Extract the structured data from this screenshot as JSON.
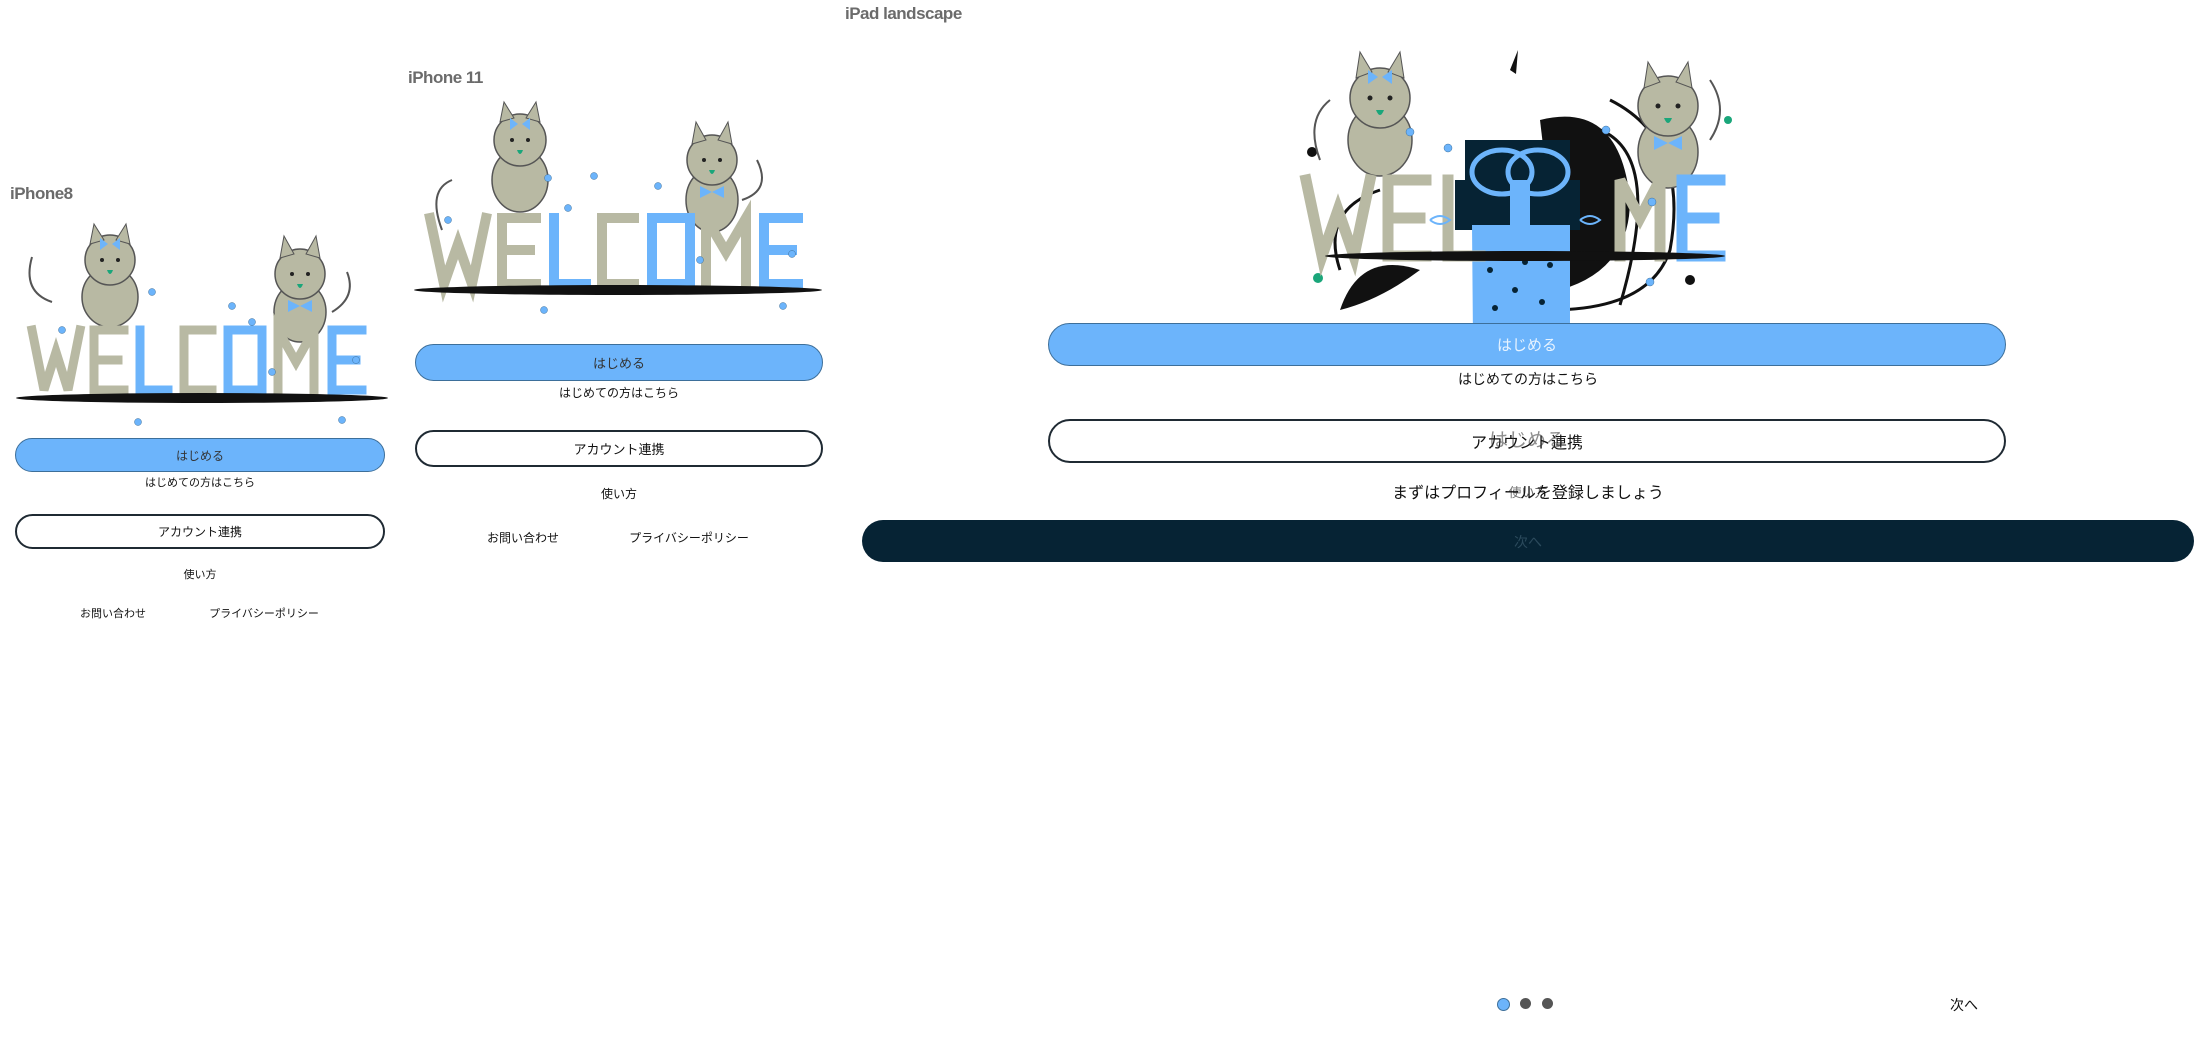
{
  "frames": {
    "phone": {
      "label": "iPhone8",
      "start_button": "はじめる",
      "first_time_text": "はじめての方はこちら",
      "account_link_button": "アカウント連携",
      "how_to_use": "使い方",
      "contact": "お問い合わせ",
      "privacy_policy": "プライバシーポリシー"
    },
    "phone11": {
      "label": "iPhone 11",
      "start_button": "はじめる",
      "first_time_text": "はじめての方はこちら",
      "account_link_button": "アカウント連携",
      "how_to_use": "使い方",
      "contact": "お問い合わせ",
      "privacy_policy": "プライバシーポリシー"
    },
    "ipad": {
      "label": "iPad landscape",
      "illustration_word": "WELCOME",
      "start_button": "はじめる",
      "overlay_start_button": "はじめる",
      "first_time_text": "はじめての方はこちら",
      "account_link_button": "アカウント連携",
      "overlay_account_text": "はじめる",
      "register_text": "まずはプロフィールを登録しましょう",
      "overlay_how_to": "使い方",
      "next_bar_label": "次へ",
      "next_button": "次へ",
      "pager_colors": [
        "#6cb4fb",
        "#555555",
        "#555555"
      ]
    }
  },
  "colors": {
    "accent": "#6cb4fb",
    "dark": "#062334",
    "cat": "#b8b9a3",
    "outline": "#1f2a33"
  }
}
